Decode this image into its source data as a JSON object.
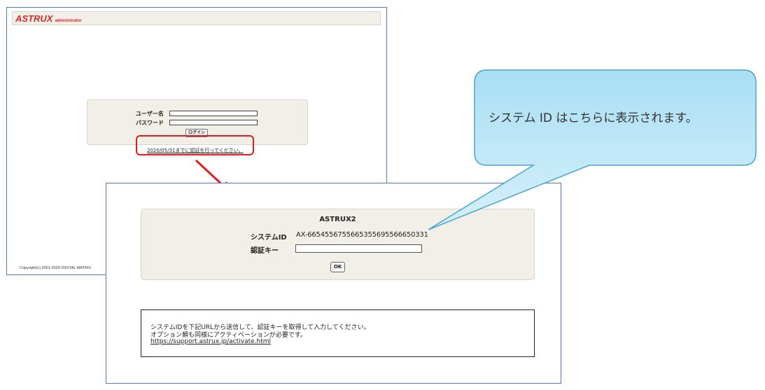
{
  "login_window": {
    "logo": "ASTRUX",
    "logo_sub": "administrator",
    "username_label": "ユーザー名",
    "password_label": "パスワード",
    "login_button": "ログイン",
    "auth_link": "2020/05/31までに認証を行ってください。",
    "copyright": "Copyright(c) 2001-2020 DIGITAL MATRIX"
  },
  "activation_window": {
    "title": "ASTRUX2",
    "system_id_label": "システムID",
    "system_id_value": "AX-6654556755665355695566650331",
    "auth_key_label": "認証キー",
    "auth_key_value": "",
    "ok_button": "OK",
    "notice_line1": "システムIDを下記URLから送信して、認証キーを取得して入力してください。",
    "notice_line2": "オプション類も同様にアクティベーションが必要です。",
    "notice_url": "https://support.astrux.jp/activate.html"
  },
  "callout": {
    "text": "システム ID はこちらに表示されます。"
  },
  "colors": {
    "highlight_red": "#e31d1d",
    "callout_fill": "#bfe6f6",
    "callout_border": "#4aa3cf",
    "window_border": "#4f7bbf",
    "panel_bg": "#f2efe9"
  }
}
